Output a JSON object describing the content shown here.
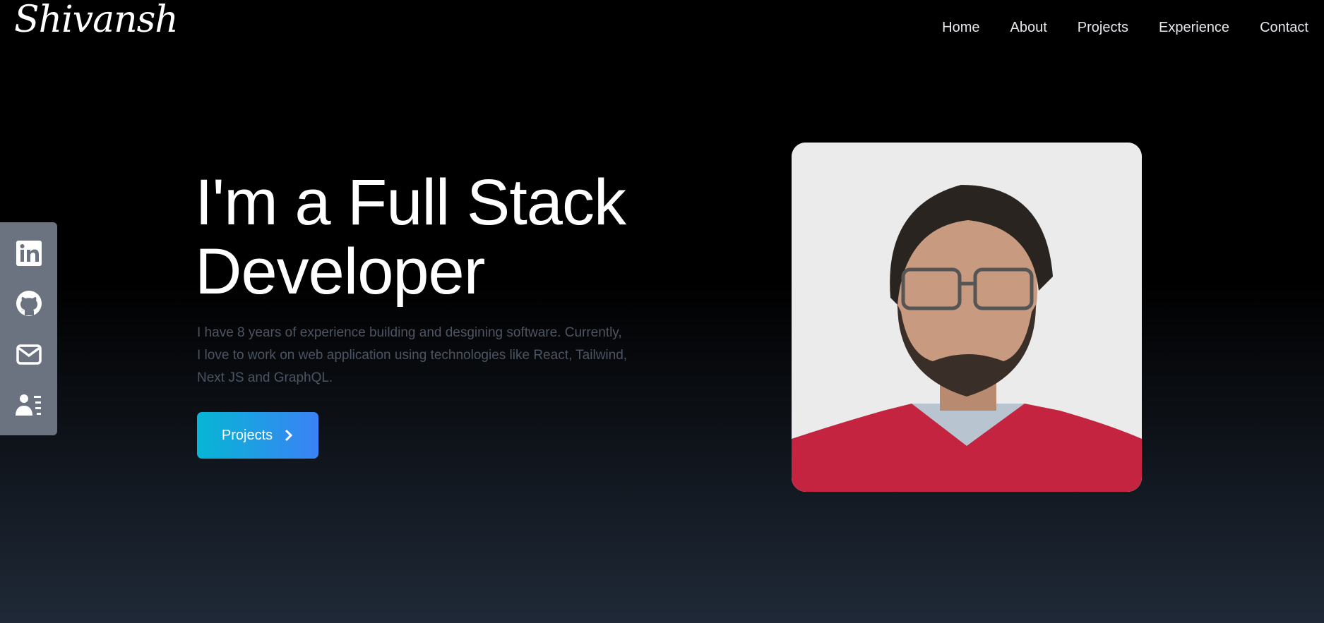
{
  "brand": {
    "logo": "Shivansh"
  },
  "nav": {
    "items": [
      {
        "label": "Home"
      },
      {
        "label": "About"
      },
      {
        "label": "Projects"
      },
      {
        "label": "Experience"
      },
      {
        "label": "Contact"
      }
    ]
  },
  "social": {
    "icons": [
      "linkedin-icon",
      "github-icon",
      "mail-icon",
      "resume-icon"
    ],
    "background": "#6b7280"
  },
  "hero": {
    "heading_line1": "I'm a Full Stack",
    "heading_line2": "Developer",
    "intro": "I have 8 years of experience building and desgining software. Currently, I love to work on web application using technologies like React, Tailwind, Next JS and GraphQL.",
    "cta_label": "Projects",
    "cta_icon": "chevron-right-icon",
    "cta_gradient": [
      "#06b6d4",
      "#3b82f6"
    ]
  }
}
